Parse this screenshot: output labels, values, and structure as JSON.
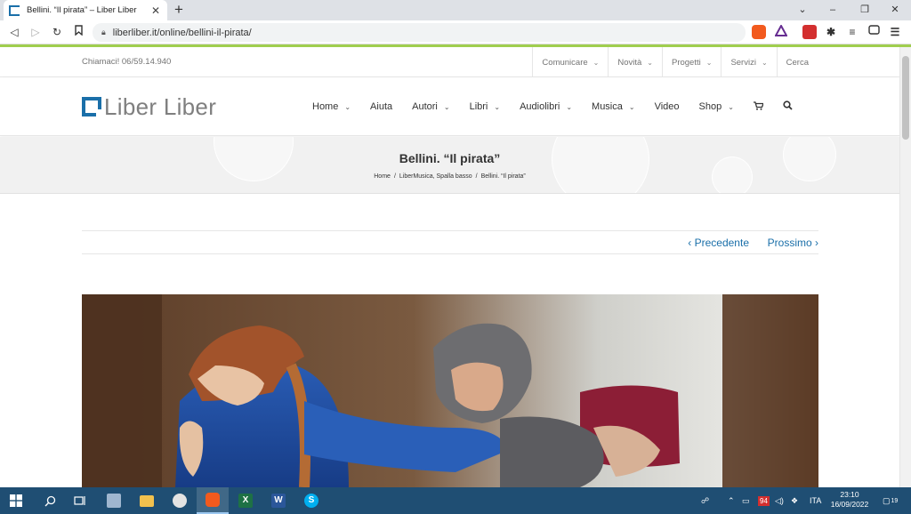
{
  "browser": {
    "tab_title": "Bellini. “Il pirata” – Liber Liber",
    "tab_close": "✕",
    "new_tab": "+",
    "url": "liberliber.it/online/bellini-il-pirata/",
    "window_controls": [
      "⌄",
      "–",
      "❐",
      "✕"
    ]
  },
  "site": {
    "call_us": "Chiamaci! 06/59.14.940",
    "top_links": [
      {
        "label": "Comunicare",
        "chevron": true
      },
      {
        "label": "Novità",
        "chevron": true
      },
      {
        "label": "Progetti",
        "chevron": true
      },
      {
        "label": "Servizi",
        "chevron": true
      },
      {
        "label": "Cerca",
        "chevron": false
      }
    ],
    "logo_text": "Liber Liber",
    "brand_color": "#1a6fa9",
    "nav": [
      {
        "label": "Home",
        "chevron": true
      },
      {
        "label": "Aiuta",
        "chevron": false
      },
      {
        "label": "Autori",
        "chevron": true
      },
      {
        "label": "Libri",
        "chevron": true
      },
      {
        "label": "Audiolibri",
        "chevron": true
      },
      {
        "label": "Musica",
        "chevron": true
      },
      {
        "label": "Video",
        "chevron": false
      },
      {
        "label": "Shop",
        "chevron": true
      }
    ],
    "page_title": "Bellini. “Il pirata”",
    "breadcrumbs": [
      "Home",
      "LiberMusica, Spalla basso",
      "Bellini. “Il pirata”"
    ],
    "prev_label": "Precedente",
    "next_label": "Prossimo"
  },
  "taskbar": {
    "tray_lang": "ITA",
    "time": "23:10",
    "date": "16/09/2022",
    "badge": "94",
    "notifications": "19"
  }
}
